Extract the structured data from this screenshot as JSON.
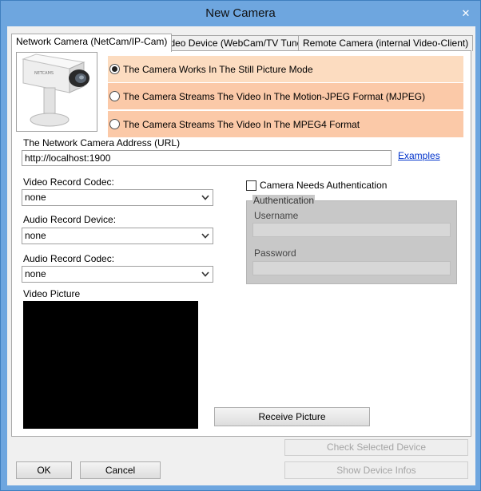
{
  "window": {
    "title": "New Camera"
  },
  "tabs": [
    {
      "label": "Network Camera (NetCam/IP-Cam)"
    },
    {
      "label": "Video Device (WebCam/TV Tuner)"
    },
    {
      "label": "Remote Camera (internal Video-Client)"
    }
  ],
  "camera_image": {
    "brand_text": "NETCAMS"
  },
  "modes": [
    {
      "label": "The Camera Works In The Still Picture Mode",
      "selected": true
    },
    {
      "label": "The Camera Streams The Video In The Motion-JPEG Format (MJPEG)",
      "selected": false
    },
    {
      "label": "The Camera Streams The Video In The MPEG4 Format",
      "selected": false
    }
  ],
  "address": {
    "label": "The Network Camera Address (URL)",
    "value": "http://localhost:1900",
    "examples_link": "Examples"
  },
  "video_codec": {
    "label": "Video Record Codec:",
    "value": "none"
  },
  "audio_device": {
    "label": "Audio Record Device:",
    "value": "none"
  },
  "audio_codec": {
    "label": "Audio Record Codec:",
    "value": "none"
  },
  "video_picture": {
    "label": "Video Picture"
  },
  "auth": {
    "checkbox_label": "Camera Needs Authentication",
    "checked": false,
    "group_title": "Authentication",
    "username_label": "Username",
    "username_value": "",
    "password_label": "Password",
    "password_value": ""
  },
  "buttons": {
    "receive": "Receive Picture",
    "check_device": "Check Selected Device",
    "show_infos": "Show Device Infos",
    "ok": "OK",
    "cancel": "Cancel"
  },
  "colors": {
    "mode_row": "#fcdcc0",
    "mode_row_alt": "#fbc9a8",
    "link": "#0033cc",
    "frame": "#6ea6df"
  }
}
